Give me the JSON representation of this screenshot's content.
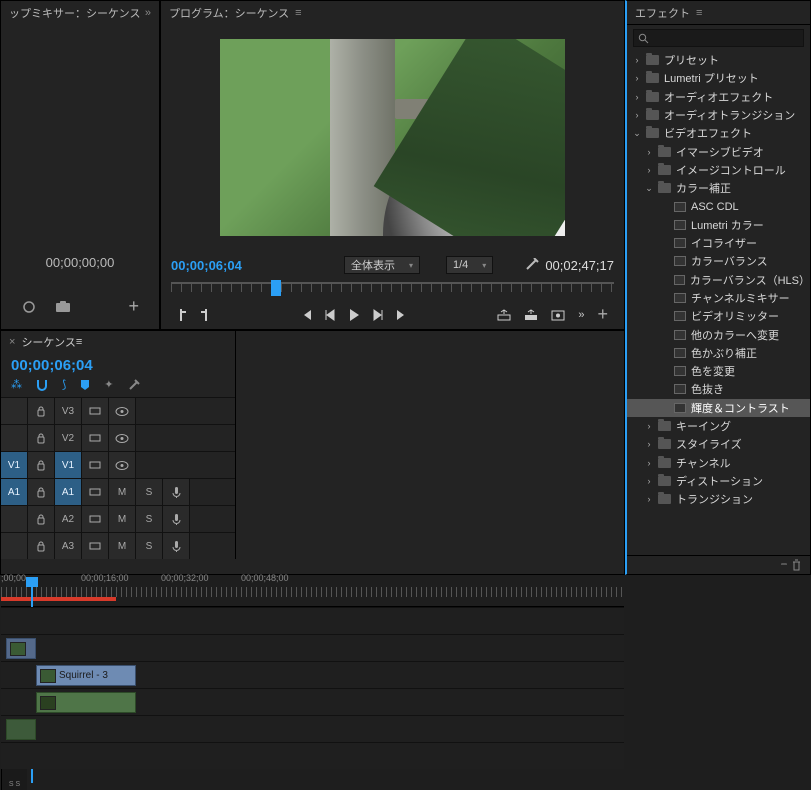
{
  "mixer": {
    "title": "ップミキサー：シーケンス",
    "timecode": "00;00;00;00"
  },
  "program": {
    "title": "プログラム：シーケンス",
    "tc_current": "00;00;06;04",
    "tc_duration": "00;02;47;17",
    "fit_label": "全体表示",
    "res_label": "1/4"
  },
  "effects": {
    "title": "エフェクト",
    "search_placeholder": "",
    "tree": [
      {
        "d": 0,
        "t": "folder",
        "open": false,
        "label": "プリセット"
      },
      {
        "d": 0,
        "t": "folder",
        "open": false,
        "label": "Lumetri プリセット"
      },
      {
        "d": 0,
        "t": "folder",
        "open": false,
        "label": "オーディオエフェクト"
      },
      {
        "d": 0,
        "t": "folder",
        "open": false,
        "label": "オーディオトランジション"
      },
      {
        "d": 0,
        "t": "folder",
        "open": true,
        "label": "ビデオエフェクト"
      },
      {
        "d": 1,
        "t": "folder",
        "open": false,
        "label": "イマーシブビデオ"
      },
      {
        "d": 1,
        "t": "folder",
        "open": false,
        "label": "イメージコントロール"
      },
      {
        "d": 1,
        "t": "folder",
        "open": true,
        "label": "カラー補正"
      },
      {
        "d": 2,
        "t": "fx",
        "label": "ASC CDL"
      },
      {
        "d": 2,
        "t": "fx",
        "label": "Lumetri カラー"
      },
      {
        "d": 2,
        "t": "fx",
        "label": "イコライザー"
      },
      {
        "d": 2,
        "t": "fx",
        "label": "カラーバランス"
      },
      {
        "d": 2,
        "t": "fx",
        "label": "カラーバランス（HLS）"
      },
      {
        "d": 2,
        "t": "fx",
        "label": "チャンネルミキサー"
      },
      {
        "d": 2,
        "t": "fx",
        "label": "ビデオリミッター"
      },
      {
        "d": 2,
        "t": "fx",
        "label": "他のカラーへ変更"
      },
      {
        "d": 2,
        "t": "fx",
        "label": "色かぶり補正"
      },
      {
        "d": 2,
        "t": "fx",
        "label": "色を変更"
      },
      {
        "d": 2,
        "t": "fx",
        "label": "色抜き"
      },
      {
        "d": 2,
        "t": "fx",
        "label": "輝度＆コントラスト",
        "sel": true
      },
      {
        "d": 1,
        "t": "folder",
        "open": false,
        "label": "キーイング"
      },
      {
        "d": 1,
        "t": "folder",
        "open": false,
        "label": "スタイライズ"
      },
      {
        "d": 1,
        "t": "folder",
        "open": false,
        "label": "チャンネル"
      },
      {
        "d": 1,
        "t": "folder",
        "open": false,
        "label": "ディストーション"
      },
      {
        "d": 1,
        "t": "folder",
        "open": false,
        "label": "トランジション"
      }
    ]
  },
  "timeline": {
    "title": "シーケンス",
    "tc": "00;00;06;04",
    "ruler": [
      ";00;00",
      "00;00;16;00",
      "00;00;32;00",
      "00;00;48;00"
    ],
    "tracks": {
      "video": [
        {
          "src": "",
          "tgt": "V3"
        },
        {
          "src": "",
          "tgt": "V2"
        },
        {
          "src": "V1",
          "tgt": "V1"
        }
      ],
      "audio": [
        {
          "src": "A1",
          "tgt": "A1"
        },
        {
          "src": "",
          "tgt": "A2"
        },
        {
          "src": "",
          "tgt": "A3"
        }
      ]
    },
    "clip_name": "Squirrel - 3",
    "meter_label": "S  S"
  }
}
